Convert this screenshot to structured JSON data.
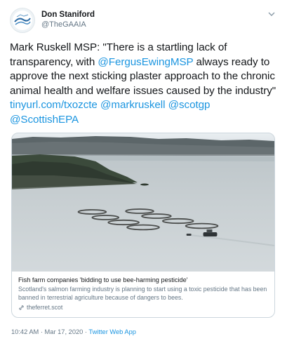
{
  "author": {
    "display_name": "Don Staniford",
    "handle": "@TheGAAIA"
  },
  "tweet": {
    "text_1": "Mark Ruskell MSP: \"There is a startling lack of transparency, with ",
    "mention_1": "@FergusEwingMSP",
    "text_2": " always ready to approve the next sticking plaster approach to the chronic animal health and welfare issues caused by the industry\" ",
    "link_1": "tinyurl.com/txozcte",
    "mention_2": "@markruskell",
    "mention_3": "@scotgp",
    "mention_4": "@ScottishEPA"
  },
  "card": {
    "title": "Fish farm companies 'bidding to use bee-harming pesticide'",
    "description": "Scotland's salmon farming industry is planning to start using a toxic pesticide that has been banned in terrestrial agriculture because of dangers to bees.",
    "domain": "theferret.scot"
  },
  "meta": {
    "timestamp": "10:42 AM · Mar 17, 2020 · ",
    "source": "Twitter Web App"
  },
  "icons": {
    "caret": "chevron-down-icon",
    "link": "link-icon"
  },
  "colors": {
    "link": "#1b95e0",
    "secondary_text": "#657786",
    "primary_text": "#14171a",
    "card_border": "#ccd6dd"
  }
}
